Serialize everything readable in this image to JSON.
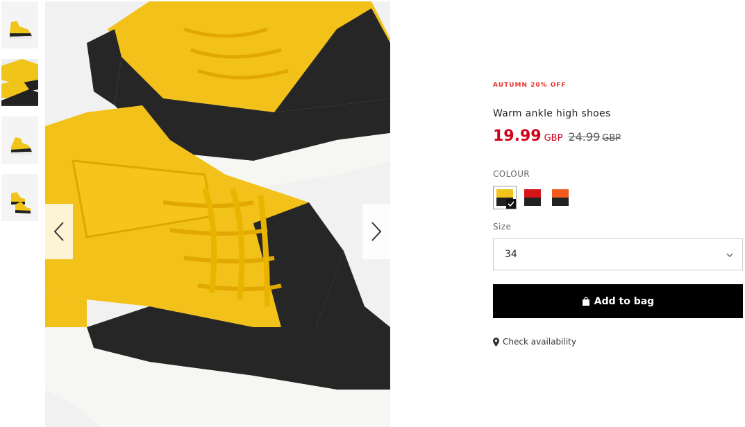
{
  "gallery": {
    "thumbnails": [
      {
        "icon": "shoe-side-thumbnail"
      },
      {
        "icon": "shoe-closeup-thumbnail"
      },
      {
        "icon": "shoe-side-thumbnail"
      },
      {
        "icon": "shoe-pair-thumbnail"
      }
    ],
    "active_index": 1,
    "prev_icon": "chevron-left-icon",
    "next_icon": "chevron-right-icon"
  },
  "product": {
    "promo": "AUTUMN 20% OFF",
    "title": "Warm ankle high shoes",
    "price_now": "19.99",
    "currency_now": "GBP",
    "price_old": "24.99",
    "currency_old": "GBP",
    "colors": {
      "sale": "#d0021b",
      "promo": "#e4332c",
      "button": "#000000"
    }
  },
  "colour": {
    "label": "COLOUR",
    "options": [
      {
        "name": "yellow-black",
        "top": "#f0c419",
        "bottom": "#222222",
        "selected": true
      },
      {
        "name": "red-black",
        "top": "#d7141a",
        "bottom": "#222222",
        "selected": false
      },
      {
        "name": "orange-black",
        "top": "#f05a1a",
        "bottom": "#222222",
        "selected": false
      }
    ]
  },
  "size": {
    "label": "Size",
    "value": "34",
    "icon": "chevron-down-icon"
  },
  "actions": {
    "add_to_bag": "Add to bag",
    "add_to_bag_icon": "shopping-bag-icon",
    "check_availability": "Check availability",
    "check_availability_icon": "map-pin-icon"
  }
}
